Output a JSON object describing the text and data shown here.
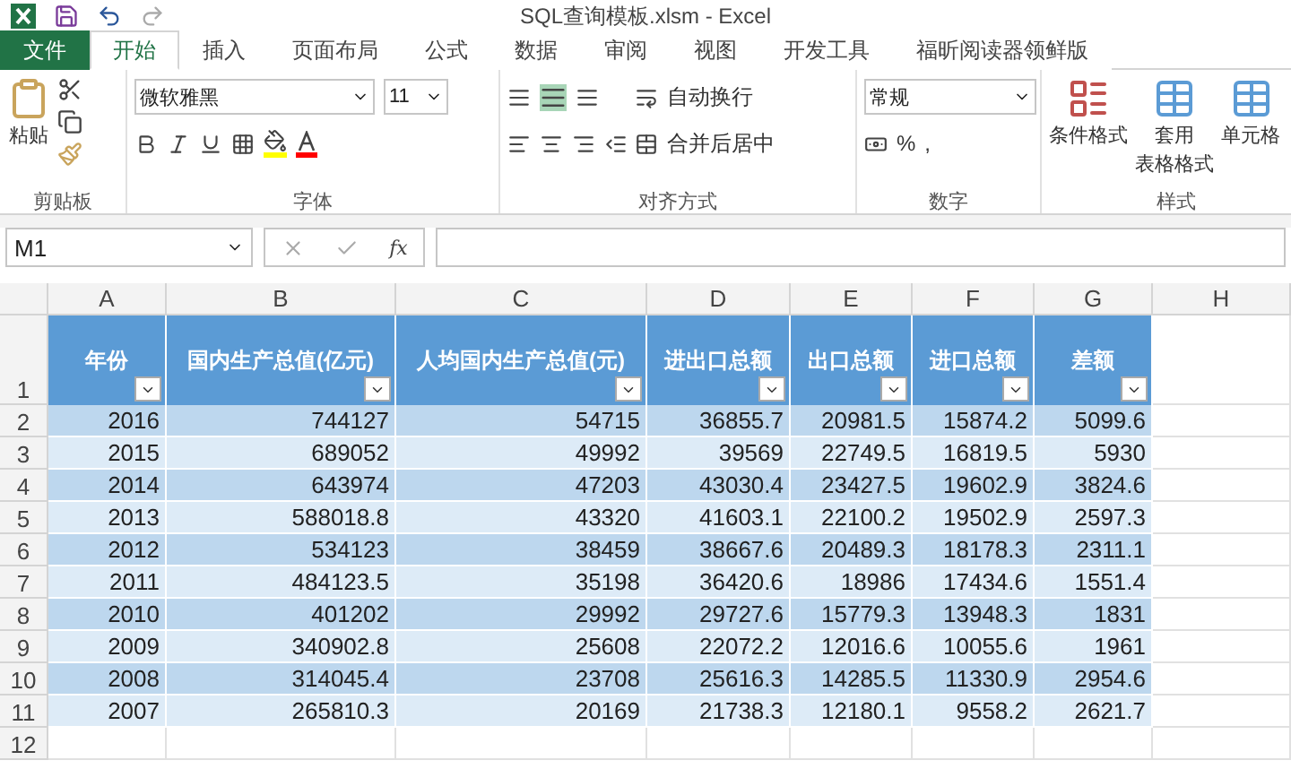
{
  "window": {
    "title": "SQL查询模板.xlsm - Excel"
  },
  "tabs": [
    {
      "label": "文件",
      "kind": "file",
      "selected": false
    },
    {
      "label": "开始",
      "kind": "tab",
      "selected": true
    },
    {
      "label": "插入",
      "kind": "tab",
      "selected": false
    },
    {
      "label": "页面布局",
      "kind": "tab",
      "selected": false
    },
    {
      "label": "公式",
      "kind": "tab",
      "selected": false
    },
    {
      "label": "数据",
      "kind": "tab",
      "selected": false
    },
    {
      "label": "审阅",
      "kind": "tab",
      "selected": false
    },
    {
      "label": "视图",
      "kind": "tab",
      "selected": false
    },
    {
      "label": "开发工具",
      "kind": "tab",
      "selected": false
    },
    {
      "label": "福昕阅读器领鲜版",
      "kind": "tab",
      "selected": false
    }
  ],
  "ribbon": {
    "clipboard": {
      "paste": "粘贴",
      "label": "剪贴板"
    },
    "font": {
      "font_name": "微软雅黑",
      "font_size": "11",
      "label": "字体"
    },
    "alignment": {
      "wrap_text": "自动换行",
      "merge_center": "合并后居中",
      "label": "对齐方式"
    },
    "number": {
      "format": "常规",
      "percent": "%",
      "comma": ",",
      "label": "数字"
    },
    "styles": {
      "conditional_format": "条件格式",
      "format_as_table": [
        "套用",
        "表格格式"
      ],
      "cell_styles": "单元格",
      "label": "样式"
    }
  },
  "formula_bar": {
    "name_box": "M1",
    "function_label": "fx"
  },
  "sheet": {
    "columns": [
      "A",
      "B",
      "C",
      "D",
      "E",
      "F",
      "G",
      "H"
    ],
    "header": {
      "row": "1",
      "cells": [
        "年份",
        "国内生产总值(亿元)",
        "人均国内生产总值(元)",
        "进出口总额",
        "出口总额",
        "进口总额",
        "差额"
      ]
    },
    "rows": [
      {
        "row": "2",
        "cells": [
          "2016",
          "744127",
          "54715",
          "36855.7",
          "20981.5",
          "15874.2",
          "5099.6"
        ]
      },
      {
        "row": "3",
        "cells": [
          "2015",
          "689052",
          "49992",
          "39569",
          "22749.5",
          "16819.5",
          "5930"
        ]
      },
      {
        "row": "4",
        "cells": [
          "2014",
          "643974",
          "47203",
          "43030.4",
          "23427.5",
          "19602.9",
          "3824.6"
        ]
      },
      {
        "row": "5",
        "cells": [
          "2013",
          "588018.8",
          "43320",
          "41603.1",
          "22100.2",
          "19502.9",
          "2597.3"
        ]
      },
      {
        "row": "6",
        "cells": [
          "2012",
          "534123",
          "38459",
          "38667.6",
          "20489.3",
          "18178.3",
          "2311.1"
        ]
      },
      {
        "row": "7",
        "cells": [
          "2011",
          "484123.5",
          "35198",
          "36420.6",
          "18986",
          "17434.6",
          "1551.4"
        ]
      },
      {
        "row": "8",
        "cells": [
          "2010",
          "401202",
          "29992",
          "29727.6",
          "15779.3",
          "13948.3",
          "1831"
        ]
      },
      {
        "row": "9",
        "cells": [
          "2009",
          "340902.8",
          "25608",
          "22072.2",
          "12016.6",
          "10055.6",
          "1961"
        ]
      },
      {
        "row": "10",
        "cells": [
          "2008",
          "314045.4",
          "23708",
          "25616.3",
          "14285.5",
          "11330.9",
          "2954.6"
        ]
      },
      {
        "row": "11",
        "cells": [
          "2007",
          "265810.3",
          "20169",
          "21738.3",
          "12180.1",
          "9558.2",
          "2621.7"
        ]
      },
      {
        "row": "12",
        "cells": []
      }
    ]
  }
}
